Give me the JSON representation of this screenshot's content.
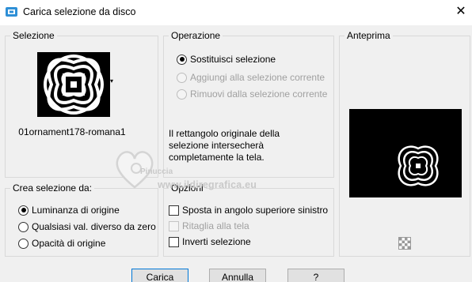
{
  "window": {
    "title": "Carica selezione da disco",
    "close_glyph": "✕"
  },
  "selection_group": {
    "legend": "Selezione",
    "thumbnail_name": "01ornament178-romana1",
    "dropdown_arrow": "▾"
  },
  "operation_group": {
    "legend": "Operazione",
    "options": [
      {
        "label": "Sostituisci selezione",
        "checked": true,
        "enabled": true
      },
      {
        "label": "Aggiungi alla selezione corrente",
        "checked": false,
        "enabled": false
      },
      {
        "label": "Rimuovi dalla selezione corrente",
        "checked": false,
        "enabled": false
      }
    ],
    "info_line1": "Il rettangolo originale della",
    "info_line2": "selezione intersecherà",
    "info_line3": "completamente la tela."
  },
  "preview_group": {
    "legend": "Anteprima",
    "transparency_icon": "checkerboard-icon"
  },
  "create_group": {
    "legend": "Crea selezione da:",
    "options": [
      {
        "label": "Luminanza di origine",
        "checked": true
      },
      {
        "label": "Qualsiasi val. diverso da zero",
        "checked": false
      },
      {
        "label": "Opacità di origine",
        "checked": false
      }
    ]
  },
  "options_group": {
    "legend": "Opzioni",
    "checks": [
      {
        "label": "Sposta in angolo superiore sinistro",
        "checked": false,
        "enabled": true
      },
      {
        "label": "Ritaglia alla tela",
        "checked": false,
        "enabled": false
      },
      {
        "label": "Inverti selezione",
        "checked": false,
        "enabled": true
      }
    ]
  },
  "watermark": {
    "name": "Pinuccia",
    "url": "www.ildiregrafica.eu"
  },
  "buttons": {
    "load": "Carica",
    "cancel": "Annulla",
    "help": "?"
  },
  "colors": {
    "focus_border": "#0078d7",
    "group_border": "#d9d9d9",
    "background": "#f0f0f0"
  }
}
